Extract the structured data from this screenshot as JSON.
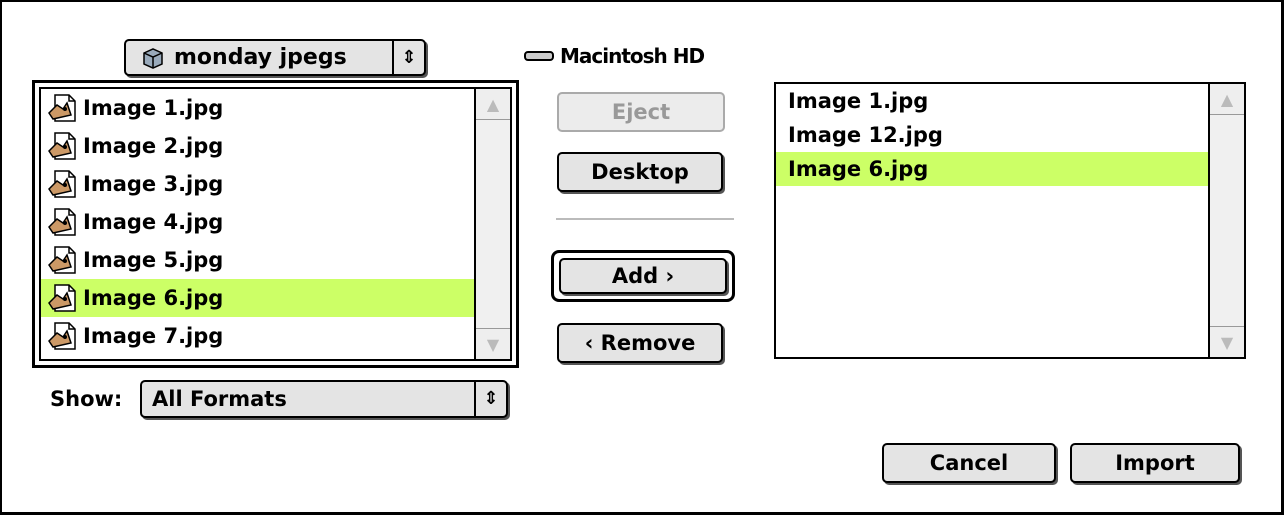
{
  "folder_popup": {
    "label": "monday jpegs",
    "icon": "folder-icon"
  },
  "disk": {
    "label": "Macintosh HD",
    "icon": "disk-icon"
  },
  "file_list": {
    "items": [
      {
        "name": "Image 1.jpg",
        "selected": false
      },
      {
        "name": "Image 2.jpg",
        "selected": false
      },
      {
        "name": "Image 3.jpg",
        "selected": false
      },
      {
        "name": "Image 4.jpg",
        "selected": false
      },
      {
        "name": "Image 5.jpg",
        "selected": false
      },
      {
        "name": "Image 6.jpg",
        "selected": true
      },
      {
        "name": "Image 7.jpg",
        "selected": false
      }
    ]
  },
  "buttons": {
    "eject": "Eject",
    "desktop": "Desktop",
    "add": "Add  ›",
    "remove": "‹ Remove",
    "cancel": "Cancel",
    "import": "Import"
  },
  "show": {
    "label": "Show:",
    "value": "All Formats"
  },
  "import_list": {
    "items": [
      {
        "name": "Image 1.jpg",
        "selected": false
      },
      {
        "name": "Image 12.jpg",
        "selected": false
      },
      {
        "name": "Image 6.jpg",
        "selected": true
      }
    ]
  },
  "colors": {
    "selection": "#ccff66",
    "button_face": "#e4e4e4"
  }
}
